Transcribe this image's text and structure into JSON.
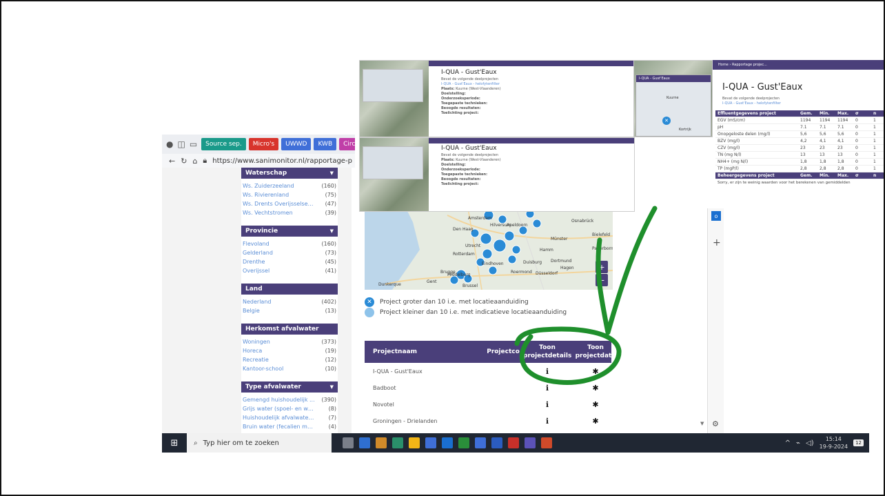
{
  "browser": {
    "favorites": [
      {
        "label": "Source sep.",
        "color": "#1a9a8a"
      },
      {
        "label": "Micro's",
        "color": "#d8342c"
      },
      {
        "label": "UWWD",
        "color": "#3f6fd8"
      },
      {
        "label": "KWB",
        "color": "#3f6fd8"
      },
      {
        "label": "Circ. w",
        "color": "#c03fa8"
      }
    ],
    "url": "https://www.sanimonitor.nl/rapportage-p"
  },
  "filters": [
    {
      "title": "Waterschap",
      "items": [
        {
          "label": "Ws. Zuiderzeeland",
          "count": "(160)"
        },
        {
          "label": "Ws. Rivierenland",
          "count": "(75)"
        },
        {
          "label": "Ws. Drents Overijsselse D...",
          "count": "(47)"
        },
        {
          "label": "Ws. Vechtstromen",
          "count": "(39)"
        }
      ]
    },
    {
      "title": "Provincie",
      "items": [
        {
          "label": "Flevoland",
          "count": "(160)"
        },
        {
          "label": "Gelderland",
          "count": "(73)"
        },
        {
          "label": "Drenthe",
          "count": "(45)"
        },
        {
          "label": "Overijssel",
          "count": "(41)"
        }
      ]
    },
    {
      "title": "Land",
      "items": [
        {
          "label": "Nederland",
          "count": "(402)"
        },
        {
          "label": "Belgie",
          "count": "(13)"
        }
      ]
    },
    {
      "title": "Herkomst afvalwater",
      "items": [
        {
          "label": "Woningen",
          "count": "(373)"
        },
        {
          "label": "Horeca",
          "count": "(19)"
        },
        {
          "label": "Recreatie",
          "count": "(12)"
        },
        {
          "label": "Kantoor-school",
          "count": "(10)"
        }
      ]
    },
    {
      "title": "Type afvalwater",
      "items": [
        {
          "label": "Gemengd huishoudelijk ...",
          "count": "(390)"
        },
        {
          "label": "Grijs water (spoel- en wa...",
          "count": "(8)"
        },
        {
          "label": "Huishoudelijk afvalwater ...",
          "count": "(7)"
        },
        {
          "label": "Bruin water (fecalien met...",
          "count": "(4)"
        }
      ]
    }
  ],
  "map": {
    "places": [
      "Amsterdam",
      "Hilversum",
      "Apeldoorn",
      "Osnabrück",
      "Den Haag",
      "Utrecht",
      "Münster",
      "Bielefeld",
      "Rotterdam",
      "Eindhoven",
      "Hamm",
      "Paderborn",
      "Middelburg",
      "Dortmund",
      "Duisburg",
      "Hagen",
      "Brugge",
      "Gent",
      "Roermond",
      "Düsseldorf",
      "Dunkerque",
      "Brussel"
    ],
    "zoom_in": "+",
    "zoom_out": "−"
  },
  "legend": {
    "large": "Project groter dan 10 i.e. met locatieaanduiding",
    "small": "Project kleiner dan 10 i.e. met indicatieve locatieaanduiding"
  },
  "projects_table": {
    "headers": [
      "Projectnaam",
      "Projectco",
      "Toon projectdetails",
      "Toon projectdata"
    ],
    "rows": [
      "I-QUA - Gust'Eaux",
      "Badboot",
      "Novotel",
      "Groningen - Drielanden"
    ],
    "detail_icon": "info-icon",
    "data_icon": "asterisk-icon"
  },
  "taskbar": {
    "search_placeholder": "Typ hier om te zoeken",
    "time": "15:14",
    "date": "19-9-2024",
    "notifications": "12"
  },
  "overlay": {
    "breadcrumb": "Home › Rapportage projec...",
    "breadcrumb_tile": "I-QUA - Gust'Eaux",
    "title": "I-QUA - Gust'Eaux",
    "subtitle": "Bevat de volgende deelprojecten",
    "subproject": "I-QUA - Gust'Eaux - helofytenfilter",
    "place_label": "Plaats:",
    "place": "Kuurne (West-Vlaanderen)",
    "goal_label": "Doelstelling:",
    "period_label": "Onderzoeksperiode:",
    "tech_label": "Toegepaste technieken:",
    "results_label": "Beoogde resultaten:",
    "explain_label": "Toelichting project:",
    "map_label": "Kortrijk",
    "map_label2": "Kuurne",
    "eff_headers": [
      "Effluentgegevens project",
      "Gem.",
      "Min.",
      "Max.",
      "σ",
      "n"
    ],
    "eff_rows": [
      [
        "EGV (mS/cm)",
        "1194",
        "1194",
        "1194",
        "0",
        "1"
      ],
      [
        "pH",
        "7.1",
        "7.1",
        "7.1",
        "0",
        "1"
      ],
      [
        "Onopgeloste delen (mg/l)",
        "5,6",
        "5,6",
        "5,6",
        "0",
        "1"
      ],
      [
        "BZV (mg/l)",
        "4,2",
        "4,1",
        "4,1",
        "0",
        "1"
      ],
      [
        "CZV (mg/l)",
        "23",
        "23",
        "23",
        "0",
        "1"
      ],
      [
        "TN (mg N/l)",
        "13",
        "13",
        "13",
        "0",
        "1"
      ],
      [
        "NH4+ (mg N/l)",
        "1,8",
        "1,8",
        "1,8",
        "0",
        "1"
      ],
      [
        "TP (mgP/l)",
        "2,8",
        "2,8",
        "2,8",
        "0",
        "1"
      ]
    ],
    "mgmt_headers": [
      "Beheergegevens project",
      "Gem.",
      "Min.",
      "Max.",
      "σ",
      "n"
    ],
    "mgmt_note": "Sorry, er zijn te weinig waarden voor het berekenen van gemiddelden"
  }
}
